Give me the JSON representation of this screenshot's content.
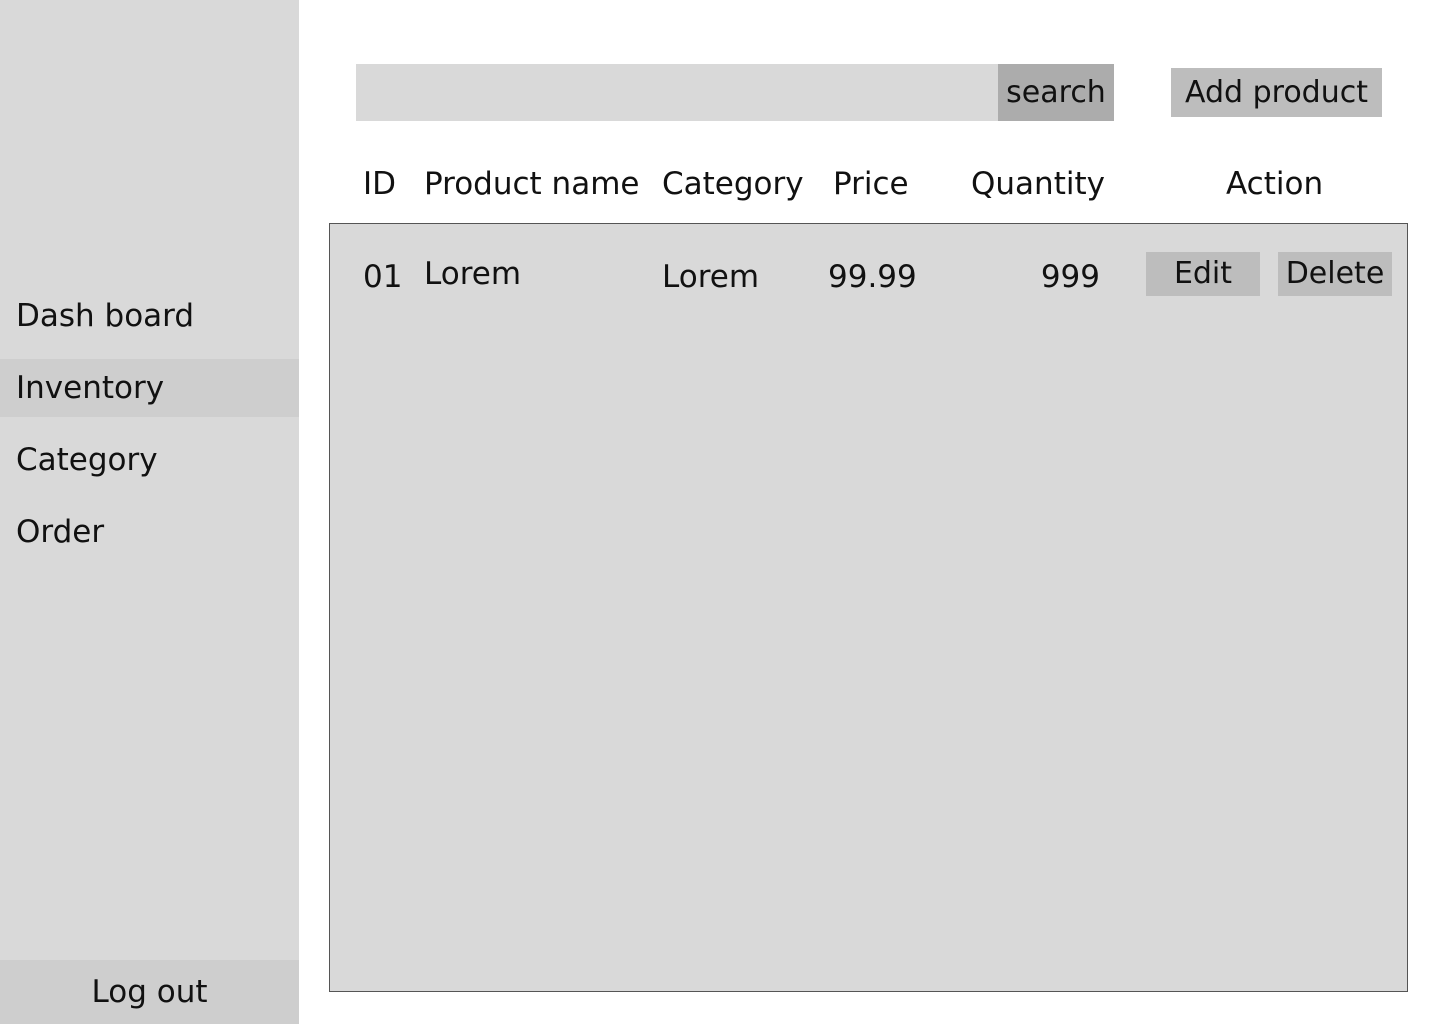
{
  "sidebar": {
    "items": [
      {
        "label": "Dash board",
        "active": false
      },
      {
        "label": "Inventory",
        "active": true
      },
      {
        "label": "Category",
        "active": false
      },
      {
        "label": "Order",
        "active": false
      }
    ],
    "logout_label": "Log out"
  },
  "search": {
    "value": "",
    "button_label": "search"
  },
  "toolbar": {
    "add_label": "Add product"
  },
  "table": {
    "columns": [
      "ID",
      "Product name",
      "Category",
      "Price",
      "Quantity",
      "Action"
    ],
    "rows": [
      {
        "id": "01",
        "name": "Lorem",
        "category": "Lorem",
        "price": "99.99",
        "quantity": "999",
        "edit_label": "Edit",
        "delete_label": "Delete"
      }
    ]
  },
  "colors": {
    "sidebar_bg": "#d9d9d9",
    "active_item_bg": "#cecece",
    "search_button_bg": "#acacac",
    "button_bg": "#bdbdbd",
    "table_bg": "#d9d9d9"
  }
}
